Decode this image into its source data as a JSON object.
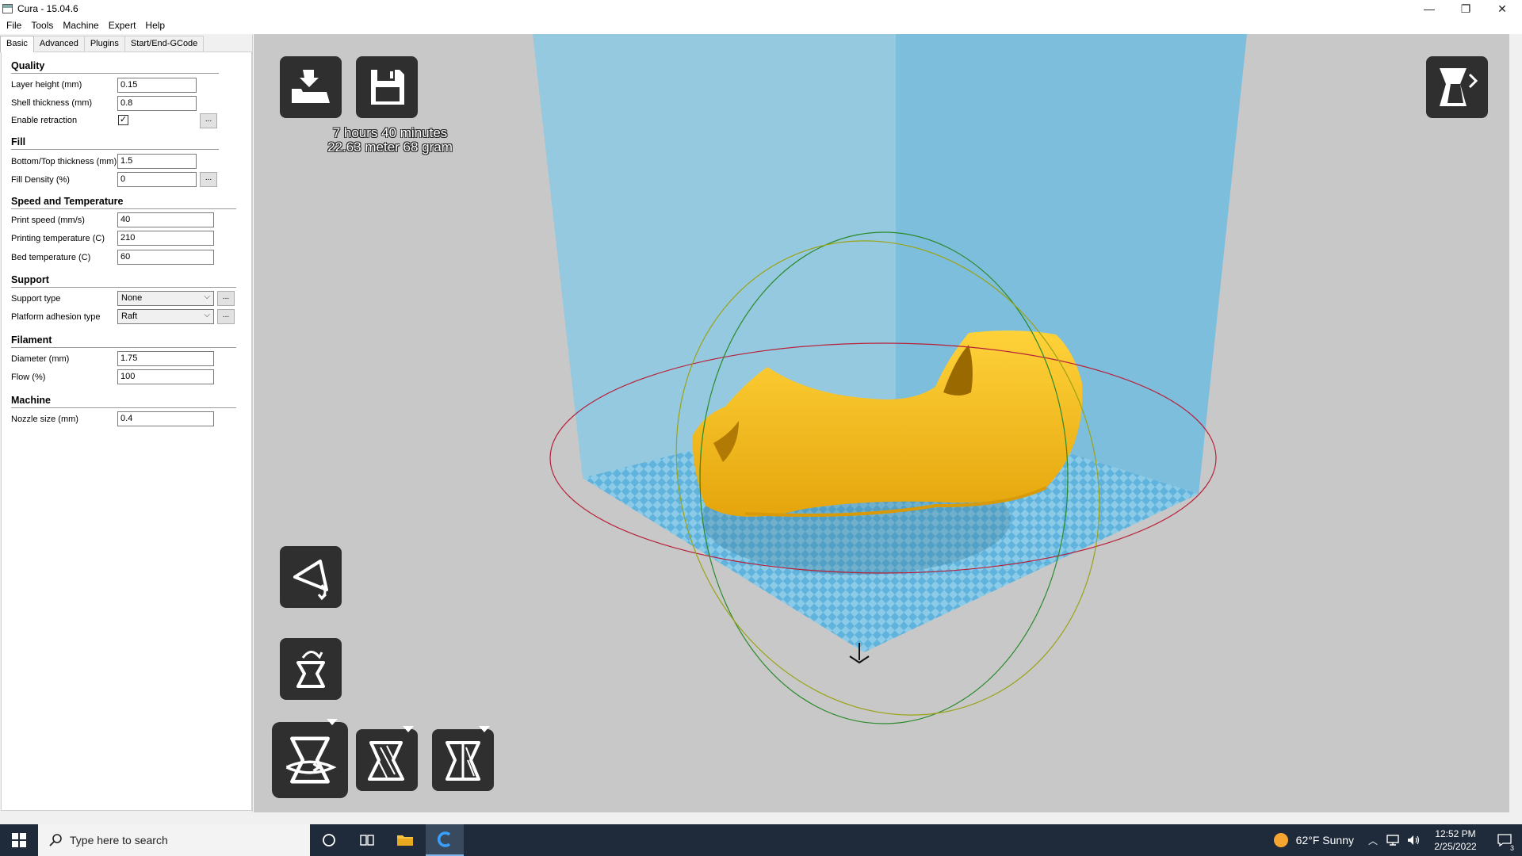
{
  "window": {
    "title": "Cura - 15.04.6",
    "minimize": "—",
    "restore": "❐",
    "close": "✕"
  },
  "menu": [
    "File",
    "Tools",
    "Machine",
    "Expert",
    "Help"
  ],
  "tabs": [
    "Basic",
    "Advanced",
    "Plugins",
    "Start/End-GCode"
  ],
  "sections": {
    "quality": {
      "title": "Quality",
      "layer_height": {
        "label": "Layer height (mm)",
        "value": "0.15"
      },
      "shell_thickness": {
        "label": "Shell thickness (mm)",
        "value": "0.8"
      },
      "enable_retraction": {
        "label": "Enable retraction",
        "checked": true,
        "check_glyph": "✓"
      }
    },
    "fill": {
      "title": "Fill",
      "bottom_top": {
        "label": "Bottom/Top thickness (mm)",
        "value": "1.5"
      },
      "fill_density": {
        "label": "Fill Density (%)",
        "value": "0"
      }
    },
    "speed": {
      "title": "Speed and Temperature",
      "print_speed": {
        "label": "Print speed (mm/s)",
        "value": "40"
      },
      "print_temp": {
        "label": "Printing temperature (C)",
        "value": "210"
      },
      "bed_temp": {
        "label": "Bed temperature (C)",
        "value": "60"
      }
    },
    "support": {
      "title": "Support",
      "support_type": {
        "label": "Support type",
        "value": "None"
      },
      "adhesion": {
        "label": "Platform adhesion type",
        "value": "Raft"
      }
    },
    "filament": {
      "title": "Filament",
      "diameter": {
        "label": "Diameter (mm)",
        "value": "1.75"
      },
      "flow": {
        "label": "Flow (%)",
        "value": "100"
      }
    },
    "machine": {
      "title": "Machine",
      "nozzle": {
        "label": "Nozzle size (mm)",
        "value": "0.4"
      }
    }
  },
  "ellipsis": "...",
  "print_info": {
    "line1": "7 hours 40 minutes",
    "line2": "22.63 meter 68 gram"
  },
  "colors": {
    "model": "#f6bd16",
    "build_volume": "#7fc2dd",
    "viewport": "#c8c8c8",
    "taskbar": "#1f2b3a"
  },
  "taskbar": {
    "search_placeholder": "Type here to search",
    "weather": "62°F  Sunny",
    "time": "12:52 PM",
    "date": "2/25/2022",
    "notifications": "3"
  }
}
